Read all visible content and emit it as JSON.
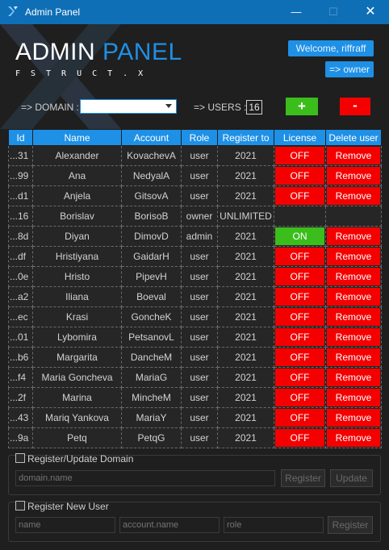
{
  "window": {
    "title": "Admin Panel",
    "minimize": "—",
    "maximize": "☐",
    "close": "✕"
  },
  "logo": {
    "word1": "ADMIN",
    "word2": "PANEL",
    "subtitle": "FSTRUCT.X"
  },
  "header": {
    "welcome": "Welcome, riffraff",
    "role": "=> owner"
  },
  "filters": {
    "domain_label": "=> DOMAIN :",
    "domain_value": "",
    "users_label": "=> USERS :",
    "users_count": "16",
    "add_label": "+",
    "remove_label": "-"
  },
  "table": {
    "columns": [
      "Id",
      "Name",
      "Account",
      "Role",
      "Register to",
      "License",
      "Delete user"
    ],
    "rows": [
      {
        "id": "...31",
        "name": "Alexander",
        "account": "KovachevA",
        "role": "user",
        "register_to": "2021",
        "license": "OFF",
        "delete": "Remove"
      },
      {
        "id": "...99",
        "name": "Ana",
        "account": "NedyalA",
        "role": "user",
        "register_to": "2021",
        "license": "OFF",
        "delete": "Remove"
      },
      {
        "id": "...d1",
        "name": "Anjela",
        "account": "GitsovA",
        "role": "user",
        "register_to": "2021",
        "license": "OFF",
        "delete": "Remove"
      },
      {
        "id": "...16",
        "name": "Borislav",
        "account": "BorisoB",
        "role": "owner",
        "register_to": "UNLIMITED",
        "license": "",
        "delete": ""
      },
      {
        "id": "...8d",
        "name": "Diyan",
        "account": "DimovD",
        "role": "admin",
        "register_to": "2021",
        "license": "ON",
        "delete": "Remove"
      },
      {
        "id": "...df",
        "name": "Hristiyana",
        "account": "GaidarH",
        "role": "user",
        "register_to": "2021",
        "license": "OFF",
        "delete": "Remove"
      },
      {
        "id": "...0e",
        "name": "Hristo",
        "account": "PipevH",
        "role": "user",
        "register_to": "2021",
        "license": "OFF",
        "delete": "Remove"
      },
      {
        "id": "...a2",
        "name": "Iliana",
        "account": "Boeval",
        "role": "user",
        "register_to": "2021",
        "license": "OFF",
        "delete": "Remove"
      },
      {
        "id": "...ec",
        "name": "Krasi",
        "account": "GoncheK",
        "role": "user",
        "register_to": "2021",
        "license": "OFF",
        "delete": "Remove"
      },
      {
        "id": "...01",
        "name": "Lybomira",
        "account": "PetsanovL",
        "role": "user",
        "register_to": "2021",
        "license": "OFF",
        "delete": "Remove"
      },
      {
        "id": "...b6",
        "name": "Margarita",
        "account": "DancheM",
        "role": "user",
        "register_to": "2021",
        "license": "OFF",
        "delete": "Remove"
      },
      {
        "id": "...f4",
        "name": "Maria Goncheva",
        "account": "MariaG",
        "role": "user",
        "register_to": "2021",
        "license": "OFF",
        "delete": "Remove"
      },
      {
        "id": "...2f",
        "name": "Marina",
        "account": "MincheM",
        "role": "user",
        "register_to": "2021",
        "license": "OFF",
        "delete": "Remove"
      },
      {
        "id": "...43",
        "name": "Mariq Yankova",
        "account": "MariaY",
        "role": "user",
        "register_to": "2021",
        "license": "OFF",
        "delete": "Remove"
      },
      {
        "id": "...9a",
        "name": "Petq",
        "account": "PetqG",
        "role": "user",
        "register_to": "2021",
        "license": "OFF",
        "delete": "Remove"
      }
    ]
  },
  "register_domain": {
    "checkbox_label": "Register/Update Domain",
    "domain_placeholder": "domain.name",
    "register_label": "Register",
    "update_label": "Update"
  },
  "register_user": {
    "checkbox_label": "Register New User",
    "name_placeholder": "name",
    "account_placeholder": "account.name",
    "role_placeholder": "role",
    "register_label": "Register"
  },
  "colors": {
    "accent": "#1e90e6",
    "on": "#3bbd1c",
    "off": "#f50000",
    "titlebar": "#0f6fb6"
  }
}
